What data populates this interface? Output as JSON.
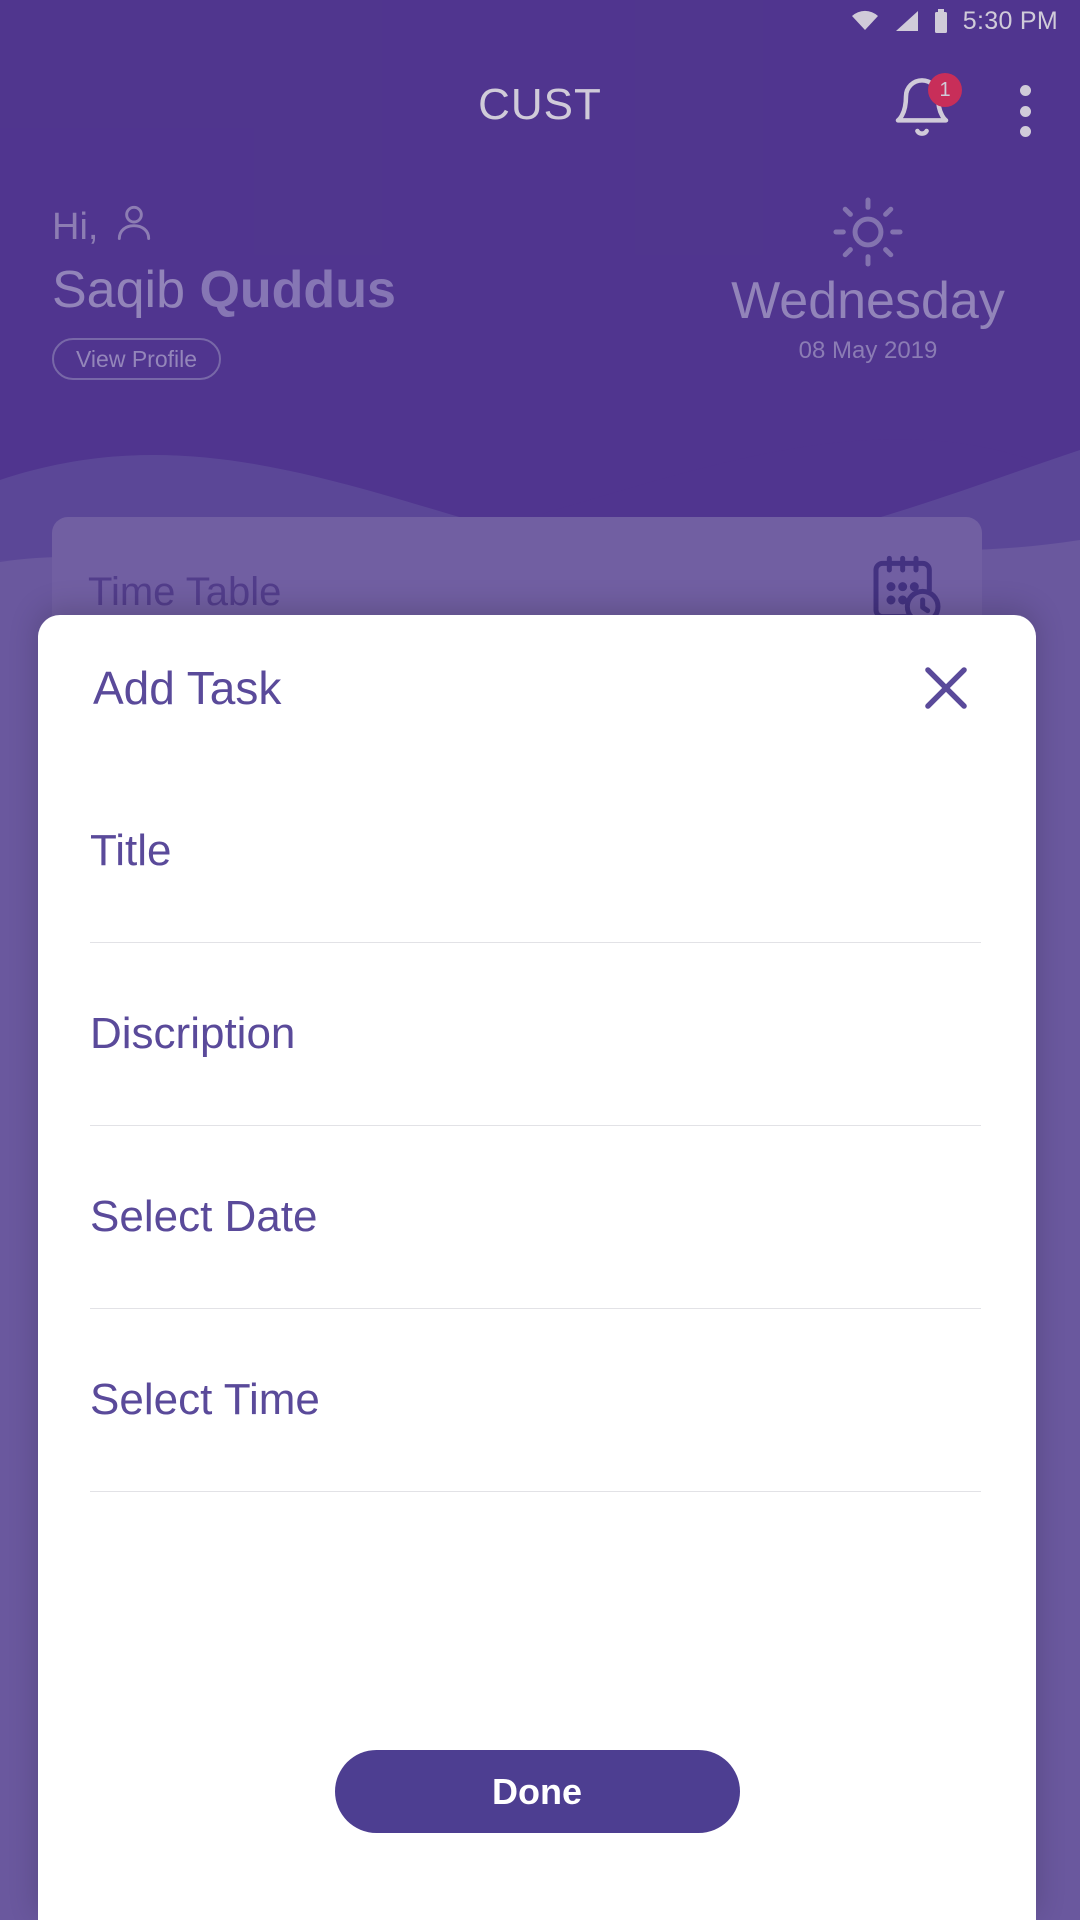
{
  "status_bar": {
    "time": "5:30 PM",
    "icons": [
      "wifi-icon",
      "cellular-signal-icon",
      "battery-icon"
    ]
  },
  "app_bar": {
    "title": "CUST",
    "notification_icon": "bell-icon",
    "notification_count": "1",
    "overflow_icon": "more-vertical-icon"
  },
  "greeting": {
    "hi_text": "Hi,",
    "person_icon": "person-icon",
    "first_name": "Saqib",
    "last_name": "Quddus",
    "view_profile_label": "View Profile"
  },
  "weather": {
    "icon": "sun-icon",
    "day": "Wednesday",
    "date": "08 May 2019"
  },
  "cards": {
    "time_table": {
      "label": "Time Table",
      "icon": "calendar-clock-icon"
    }
  },
  "dialog": {
    "title": "Add Task",
    "close_icon": "close-icon",
    "fields": [
      {
        "name": "title",
        "placeholder": "Title",
        "value": ""
      },
      {
        "name": "description",
        "placeholder": "Discription",
        "value": ""
      },
      {
        "name": "date",
        "placeholder": "Select Date",
        "value": ""
      },
      {
        "name": "time",
        "placeholder": "Select Time",
        "value": ""
      }
    ],
    "done_label": "Done"
  },
  "colors": {
    "header_purple": "#5b3fa0",
    "body_purple": "#7d6cb4",
    "card_purple": "#8675b9",
    "accent_purple": "#4d3e91",
    "text_purple": "#5a4a9a",
    "badge_red": "#f5365c",
    "dialog_white": "#ffffff"
  }
}
